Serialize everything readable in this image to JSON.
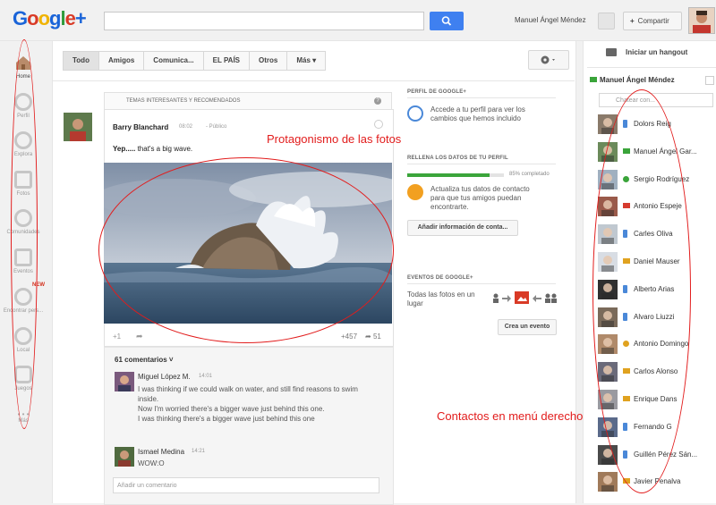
{
  "header": {
    "logo_text": "Google+",
    "user_name": "Manuel Ángel Méndez",
    "share_label": "Compartir"
  },
  "leftnav": {
    "items": [
      {
        "label": "Home"
      },
      {
        "label": "Perfil"
      },
      {
        "label": "Explora"
      },
      {
        "label": "Fotos"
      },
      {
        "label": "Comunidades"
      },
      {
        "label": "Eventos"
      },
      {
        "label": "Encontrar pers..."
      },
      {
        "label": "Local"
      },
      {
        "label": "Juegos"
      },
      {
        "label": "Más"
      }
    ],
    "new_badge": "NEW"
  },
  "tabs": [
    "Todo",
    "Amigos",
    "Comunica...",
    "EL PAÍS",
    "Otros",
    "Más"
  ],
  "post": {
    "section_title": "TEMAS INTERESANTES Y RECOMENDADOS",
    "author": "Barry Blanchard",
    "time": "08:02",
    "privacy": "Público",
    "text_bold": "Yep.....",
    "text_rest": " that's a big wave.",
    "plus_one": "+1",
    "plus_count": "+457",
    "share_count": "51"
  },
  "comments": {
    "count_label": "61 comentarios",
    "items": [
      {
        "name": "Miguel López M.",
        "time": "14:01",
        "lines": [
          "I was thinking if we could walk on water, and still find reasons to swim",
          "inside.",
          "Now I'm worried there's a bigger wave just behind this one.",
          "I was thinking there's a bigger wave just behind this one"
        ]
      },
      {
        "name": "Ismael Medina",
        "time": "14:21",
        "lines": [
          "WOW:O"
        ]
      }
    ],
    "add_placeholder": "Añadir un comentario"
  },
  "middle": {
    "profile_title": "PERFIL DE GOOGLE+",
    "profile_text": [
      "Accede a tu perfil para ver los",
      "cambios que hemos incluido"
    ],
    "fill_title": "RELLENA LOS DATOS DE TU PERFIL",
    "progress_pct": 85,
    "progress_label": "85% completado",
    "fill_text": [
      "Actualiza tus datos de contacto",
      "para que tus amigos puedan",
      "encontrarte."
    ],
    "fill_button": "Añadir información de conta...",
    "events_title": "EVENTOS DE GOOGLE+",
    "events_text": [
      "Todas las fotos en un",
      "lugar"
    ],
    "events_button": "Crea un evento"
  },
  "right": {
    "hangout_label": "Iniciar un hangout",
    "me_name": "Manuel Ángel Méndez",
    "chat_placeholder": "Chatear con...",
    "contacts": [
      {
        "name": "Dolors Reig",
        "status": "phone"
      },
      {
        "name": "Manuel Ángel Gar...",
        "status": "cam-g"
      },
      {
        "name": "Sergio Rodríguez",
        "status": "dot-g"
      },
      {
        "name": "Antonio Espeje",
        "status": "cam-r"
      },
      {
        "name": "Carles Oliva",
        "status": "phone"
      },
      {
        "name": "Daniel Mauser",
        "status": "cam-y"
      },
      {
        "name": "Alberto Arias",
        "status": "phone"
      },
      {
        "name": "Alvaro Liuzzi",
        "status": "phone"
      },
      {
        "name": "Antonio Domingo",
        "status": "dot-y"
      },
      {
        "name": "Carlos Alonso",
        "status": "cam-y"
      },
      {
        "name": "Enrique Dans",
        "status": "cam-y"
      },
      {
        "name": "Fernando G",
        "status": "phone"
      },
      {
        "name": "Guillén Pérez Sán...",
        "status": "phone"
      },
      {
        "name": "Javier Penalva",
        "status": "cam-y"
      }
    ]
  },
  "annotations": {
    "photos": "Protagonismo de las fotos",
    "contacts": "Contactos en menú derecho",
    "color": "#e21c1c"
  },
  "colors": {
    "search_blue": "#3f80f0",
    "progress_green": "#3ba53b",
    "annotation_red": "#e21c1c"
  }
}
